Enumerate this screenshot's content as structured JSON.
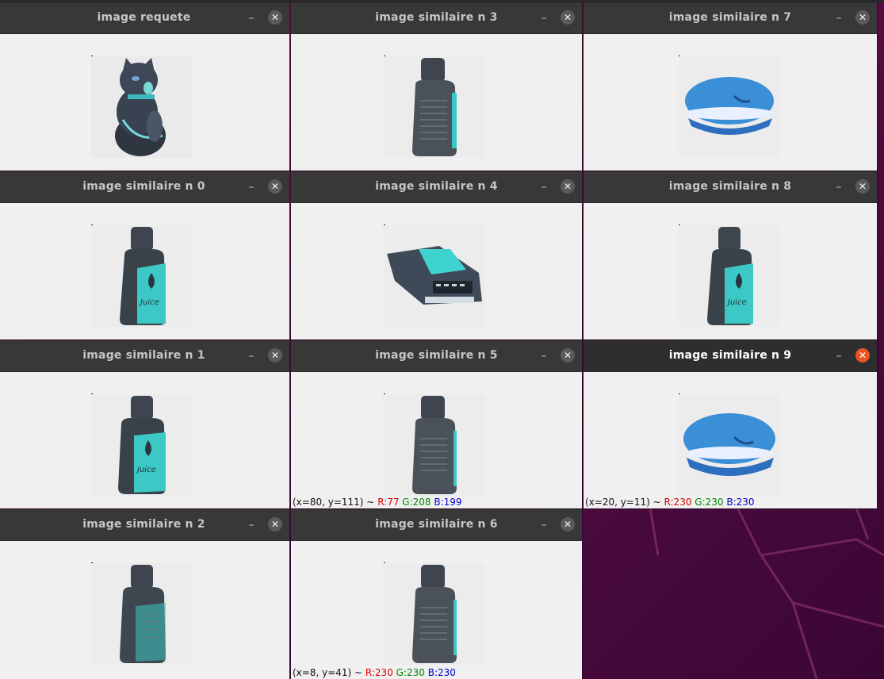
{
  "windows": [
    {
      "id": "query",
      "title": "image requete",
      "image": "maneki-neko-cat"
    },
    {
      "id": "sim3",
      "title": "image similaire n 3",
      "image": "bottle"
    },
    {
      "id": "sim7",
      "title": "image similaire n 7",
      "image": "burger"
    },
    {
      "id": "sim0",
      "title": "image similaire n 0",
      "image": "bottle-label"
    },
    {
      "id": "sim4",
      "title": "image similaire n 4",
      "image": "toy-car"
    },
    {
      "id": "sim8",
      "title": "image similaire n 8",
      "image": "bottle-label"
    },
    {
      "id": "sim1",
      "title": "image similaire n 1",
      "image": "bottle-label"
    },
    {
      "id": "sim5",
      "title": "image similaire n 5",
      "image": "bottle",
      "status": {
        "coords": "(x=80, y=111) ~",
        "r": "R:77",
        "g": "G:208",
        "b": "B:199"
      }
    },
    {
      "id": "sim9",
      "title": "image similaire n 9",
      "image": "burger",
      "active": true,
      "status": {
        "coords": "(x=20, y=11) ~",
        "r": "R:230",
        "g": "G:230",
        "b": "B:230"
      }
    },
    {
      "id": "sim2",
      "title": "image similaire n 2",
      "image": "bottle"
    },
    {
      "id": "sim6",
      "title": "image similaire n 6",
      "image": "bottle",
      "status": {
        "coords": "(x=8, y=41) ~",
        "r": "R:230",
        "g": "G:230",
        "b": "B:230"
      }
    }
  ],
  "icons": {
    "minimize": "minimize-icon",
    "close": "close-icon"
  },
  "glyphs": {
    "minimize": "–",
    "close": "✕"
  },
  "colors": {
    "accent_close": "#e95420",
    "status_r": "#e00000",
    "status_g": "#008800",
    "status_b": "#0000cc"
  }
}
